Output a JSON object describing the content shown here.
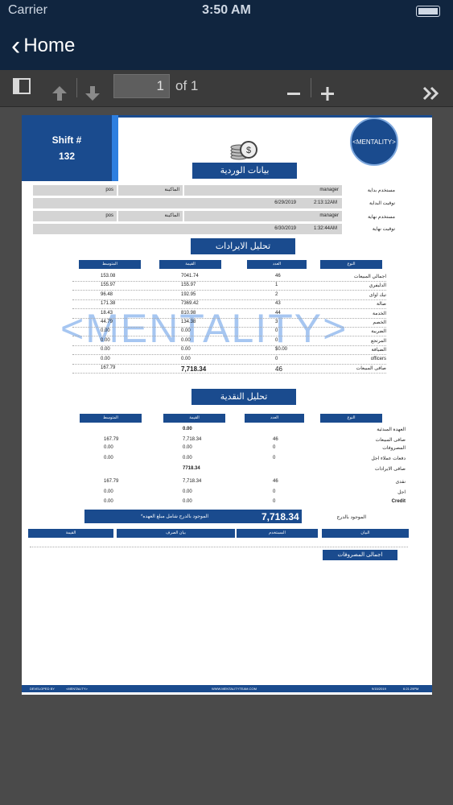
{
  "status_bar": {
    "carrier": "Carrier",
    "time": "3:50 AM"
  },
  "nav": {
    "back_label": "Home"
  },
  "toolbar": {
    "page_value": "1",
    "of_label": "of 1"
  },
  "icons": {
    "sidebar": "sidebar-toggle-icon",
    "up": "arrow-up-icon",
    "down": "arrow-down-icon",
    "minus": "zoom-out-icon",
    "plus": "zoom-in-icon",
    "forward": "double-chevron-icon"
  },
  "report": {
    "shift_label": "Shift #",
    "shift_number": "132",
    "logo_text": "<MENTALITY>",
    "watermark": "<MENTALITY>",
    "shift_data_title": "بيانات الوردية",
    "start_user_label": "مستخدم بداية",
    "start_user": "manager",
    "machine_label": "الماكينة",
    "machine": "pos",
    "start_time_label": "توقيت البداية",
    "start_date": "6/29/2019",
    "start_time": "2:13:12AM",
    "end_user_label": "مستخدم نهاية",
    "end_user": "manager",
    "machine_label2": "الماكينة",
    "machine2": "pos",
    "end_time_label": "توقيت نهاية",
    "end_date": "6/30/2019",
    "end_time": "1:32:44AM",
    "revenue_title": "تحليل الايرادات",
    "revenue_headers": {
      "type": "النوع",
      "count": "العدد",
      "value": "القيمة",
      "avg": "المتوسط"
    },
    "revenue_rows": [
      {
        "label": "اجمالي المبيعات",
        "count": "46",
        "value": "7041.74",
        "avg": "153.08"
      },
      {
        "label": "الدليفري",
        "count": "1",
        "value": "155.97",
        "avg": "155.97"
      },
      {
        "label": "تيك اواى",
        "count": "2",
        "value": "192.95",
        "avg": "96.48"
      },
      {
        "label": "صالة",
        "count": "43",
        "value": "7369.42",
        "avg": "171.38"
      },
      {
        "label": "الخدمة",
        "count": "44",
        "value": "810.98",
        "avg": "18.43"
      },
      {
        "label": "الخصم",
        "count": "3",
        "value": "134.38",
        "avg": "44.79"
      },
      {
        "label": "الضريبة",
        "count": "0",
        "value": "0.00",
        "avg": "0.00"
      },
      {
        "label": "المرتجع",
        "count": "0",
        "value": "0.00",
        "avg": "0.00"
      },
      {
        "label": "الضيافة",
        "count": "$0.00",
        "value": "0.00",
        "avg": "0.00"
      },
      {
        "label": "officers",
        "count": "0",
        "value": "0.00",
        "avg": "0.00"
      },
      {
        "label": "صافى المبيعات",
        "count": "46",
        "value": "7,718.34",
        "avg": "167.79"
      }
    ],
    "cash_title": "تحليل النقدية",
    "cash_headers": {
      "type": "النوع",
      "count": "العدد",
      "value": "القيمة",
      "avg": "المتوسط"
    },
    "cash_rows": [
      {
        "label": "العهدة المبدئية",
        "count": "",
        "value": "0.00",
        "avg": ""
      },
      {
        "label": "صافى المبيعات",
        "count": "46",
        "value": "7,718.34",
        "avg": "167.79"
      },
      {
        "label": "المصروفات",
        "count": "0",
        "value": "0.00",
        "avg": "0.00"
      },
      {
        "label": "دفعات عملاء اجل",
        "count": "0",
        "value": "0.00",
        "avg": "0.00"
      },
      {
        "label": "صافى الايرادات",
        "count": "",
        "value": "7718.34",
        "avg": ""
      },
      {
        "label": "نقدى",
        "count": "46",
        "value": "7,718.34",
        "avg": "167.79"
      },
      {
        "label": "اجل",
        "count": "0",
        "value": "0.00",
        "avg": "0.00"
      },
      {
        "label": "Credit",
        "count": "0",
        "value": "0.00",
        "avg": "0.00"
      }
    ],
    "drawer_label": "الموجود بالدرج",
    "drawer_total": "7,718.34",
    "drawer_note": "*الموجود بالدرج شامل مبلغ العهده",
    "expense_headers": {
      "item": "البيان",
      "user": "المستخدم",
      "kind": "بيان الصرف",
      "value": "القيمة"
    },
    "expenses_total_label": "اجمالى المصروفات",
    "footer_dev": "DEVELOPED BY",
    "footer_logo": "<MENTALITY>",
    "footer_site": "WWW.MENTALITYTEAM.COM",
    "footer_date": "9/15/2019",
    "footer_time": "6:21:29PM"
  },
  "colors": {
    "nav": "#10253f",
    "brand": "#1a4b8e",
    "accent": "#2d7fe0",
    "watermark": "#5d97e6"
  }
}
